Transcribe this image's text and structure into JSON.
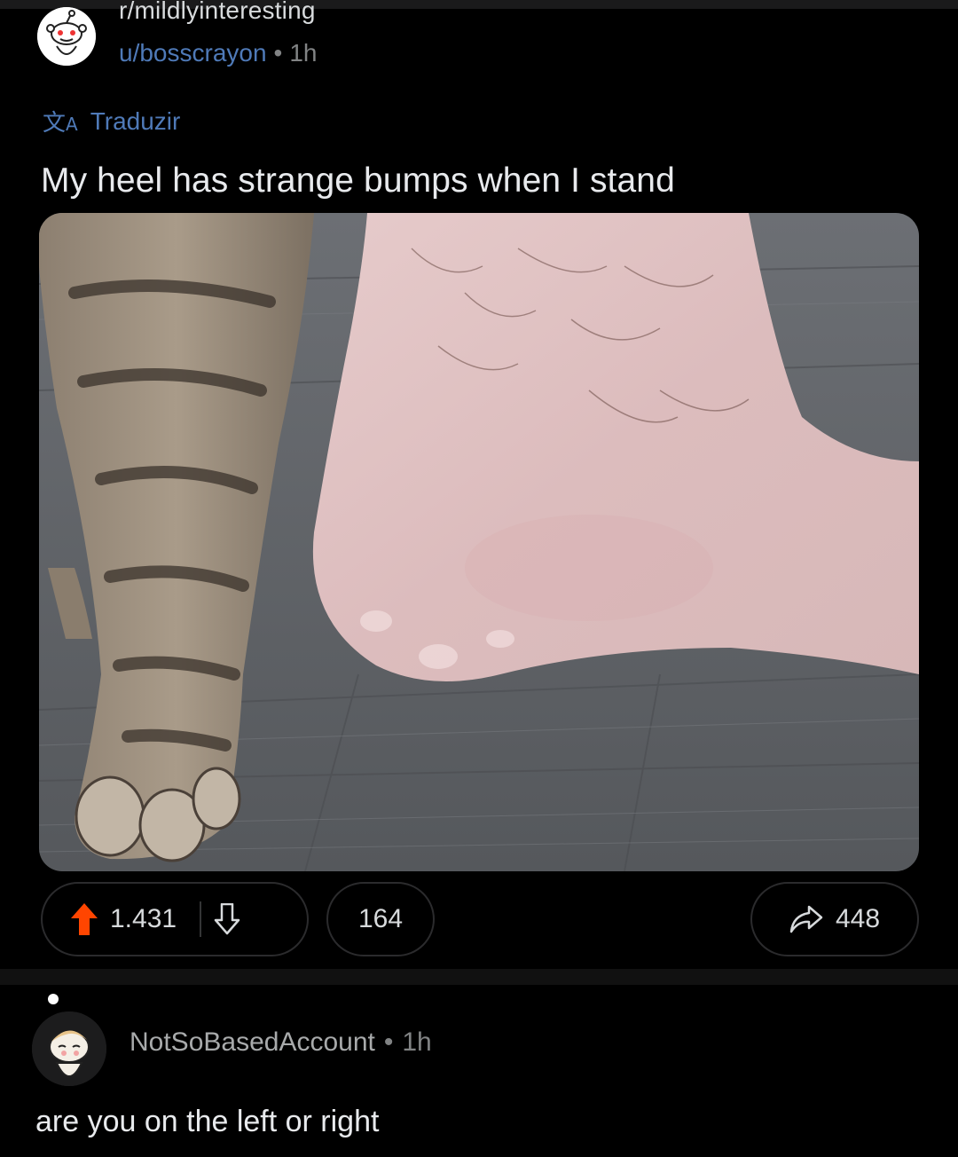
{
  "post": {
    "subreddit": "r/mildlyinteresting",
    "author": "u/bosscrayon",
    "time": "1h",
    "translate_label": "Traduzir",
    "title": "My heel has strange bumps when I stand"
  },
  "actions": {
    "upvotes": "1.431",
    "comments": "164",
    "shares": "448",
    "upvote_color": "#ff4500"
  },
  "comment": {
    "author": "NotSoBasedAccount",
    "time": "1h",
    "body": "are you on the left or right"
  },
  "icons": {
    "translate": "translate-icon",
    "upvote": "upvote-arrow-icon",
    "downvote": "downvote-arrow-icon",
    "share": "share-arrow-icon"
  }
}
